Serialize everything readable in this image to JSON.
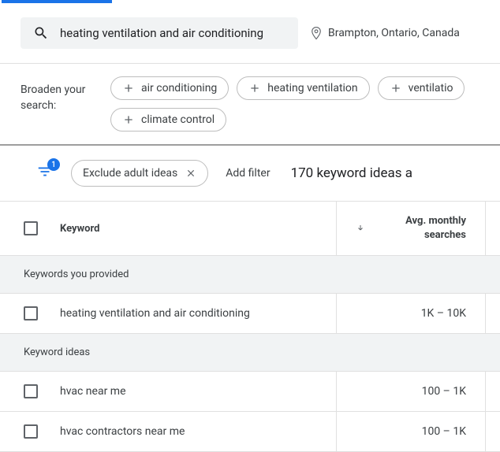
{
  "search": {
    "query": "heating ventilation and air conditioning",
    "location": "Brampton, Ontario, Canada"
  },
  "broaden": {
    "label": "Broaden your search:",
    "chips": [
      "air conditioning",
      "heating ventilation",
      "ventilatio",
      "climate control"
    ]
  },
  "filters": {
    "badge": "1",
    "exclude": "Exclude adult ideas",
    "add": "Add filter",
    "count": "170 keyword ideas a"
  },
  "table": {
    "h_keyword": "Keyword",
    "h_searches": "Avg. monthly searches"
  },
  "sections": {
    "provided": "Keywords you provided",
    "ideas": "Keyword ideas"
  },
  "rows": {
    "provided": [
      {
        "kw": "heating ventilation and air conditioning",
        "val": "1K – 10K"
      }
    ],
    "ideas": [
      {
        "kw": "hvac near me",
        "val": "100 – 1K"
      },
      {
        "kw": "hvac contractors near me",
        "val": "100 – 1K"
      }
    ]
  }
}
